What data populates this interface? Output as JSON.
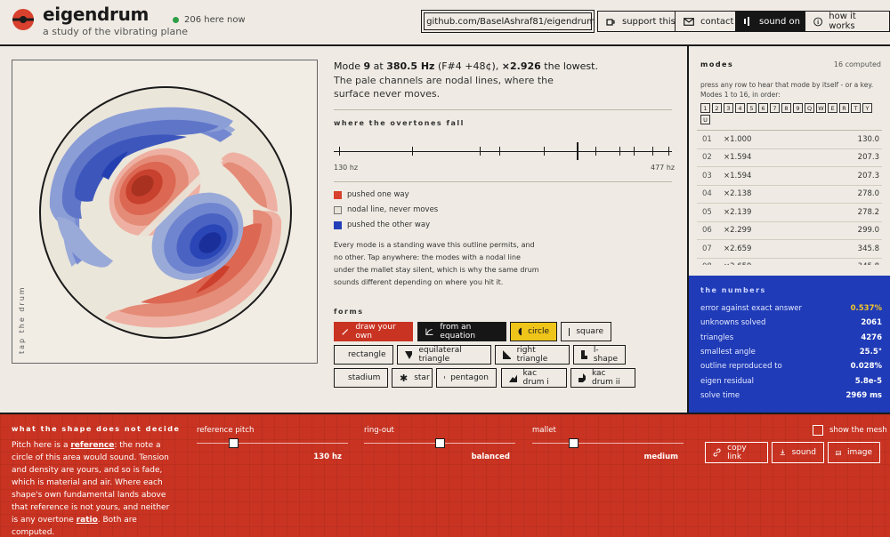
{
  "header": {
    "title": "eigendrum",
    "subtitle": "a study of the vibrating plane",
    "online_count": "206 here now",
    "buttons": {
      "github": "github.com/BaselAshraf81/eigendrum",
      "support": "support this",
      "contact": "contact",
      "sound": "sound on",
      "how": "how it works"
    }
  },
  "canvas": {
    "tap_label": "tap the drum"
  },
  "mode_info": {
    "prefix": "Mode",
    "number": "9",
    "at": "at",
    "freq": "380.5 Hz",
    "note": "(F#4 +48¢),",
    "ratio": "×2.926",
    "suffix": "the lowest.",
    "description": "The pale channels are nodal lines, where the surface never moves."
  },
  "overtones": {
    "title": "where the overtones fall",
    "min_label": "130 hz",
    "max_label": "477 hz",
    "range": [
      130,
      477
    ],
    "highlight_hz": 380.5,
    "tick_hz": [
      130,
      207.3,
      207.3,
      278,
      278.2,
      299,
      345.8,
      380.5,
      400,
      425,
      440,
      460,
      477
    ]
  },
  "legend": {
    "pushed_one": "pushed one way",
    "nodal": "nodal line, never moves",
    "pushed_other": "pushed the other way",
    "colors": {
      "red": "#d8412e",
      "nodal": "#e9e4d8",
      "blue": "#2340b8"
    }
  },
  "explanation": "Every mode is a standing wave this outline permits, and no other. Tap anywhere: the modes with a nodal line under the mallet stay silent, which is why the same drum sounds different depending on where you hit it.",
  "forms": {
    "title": "forms",
    "draw_own": "draw your own",
    "from_equation": "from an equation",
    "circle": "circle",
    "square": "square",
    "rectangle": "rectangle",
    "equilateral_triangle": "equilateral triangle",
    "right_triangle": "right triangle",
    "lshape": "l-shape",
    "stadium": "stadium",
    "star": "star",
    "pentagon": "pentagon",
    "kac_i": "kac drum i",
    "kac_ii": "kac drum ii"
  },
  "modes": {
    "title": "modes",
    "count": "16 computed",
    "help": "press any row to hear that mode by itself - or a key. Modes 1 to 16, in order:",
    "keys": [
      "1",
      "2",
      "3",
      "4",
      "5",
      "6",
      "7",
      "8",
      "9",
      "Q",
      "W",
      "E",
      "R",
      "T",
      "Y",
      "U"
    ],
    "rows": [
      {
        "n": "01",
        "ratio": "×1.000",
        "freq": "130.0"
      },
      {
        "n": "02",
        "ratio": "×1.594",
        "freq": "207.3"
      },
      {
        "n": "03",
        "ratio": "×1.594",
        "freq": "207.3"
      },
      {
        "n": "04",
        "ratio": "×2.138",
        "freq": "278.0"
      },
      {
        "n": "05",
        "ratio": "×2.139",
        "freq": "278.2"
      },
      {
        "n": "06",
        "ratio": "×2.299",
        "freq": "299.0"
      },
      {
        "n": "07",
        "ratio": "×2.659",
        "freq": "345.8"
      },
      {
        "n": "08",
        "ratio": "×2.659",
        "freq": "345.8"
      }
    ]
  },
  "numbers": {
    "title": "the numbers",
    "rows": [
      {
        "k": "error against exact answer",
        "v": "0.537%"
      },
      {
        "k": "unknowns solved",
        "v": "2061"
      },
      {
        "k": "triangles",
        "v": "4276"
      },
      {
        "k": "smallest angle",
        "v": "25.5°"
      },
      {
        "k": "outline reproduced to",
        "v": "0.028%"
      },
      {
        "k": "eigen residual",
        "v": "5.8e-5"
      },
      {
        "k": "solve time",
        "v": "2969 ms"
      }
    ]
  },
  "bottom": {
    "title": "what the shape does not decide",
    "text_1": "Pitch here is a",
    "text_ref": "reference",
    "text_2": ": the note a circle of this area would sound. Tension and density are yours, and so is fade, which is material and air. Where each shape's own fundamental lands above that reference is not yours, and neither is any overtone",
    "text_ratio": "ratio",
    "text_3": ". Both are computed.",
    "sliders": {
      "pitch_label": "reference pitch",
      "pitch_value": "130 hz",
      "pitch_level": 0.24,
      "ring_label": "ring-out",
      "ring_value": "balanced",
      "ring_level": 0.5,
      "mallet_label": "mallet",
      "mallet_value": "medium",
      "mallet_level": 0.27
    },
    "show_mesh": "show the mesh",
    "copy_link": "copy link",
    "sound": "sound",
    "image": "image"
  }
}
